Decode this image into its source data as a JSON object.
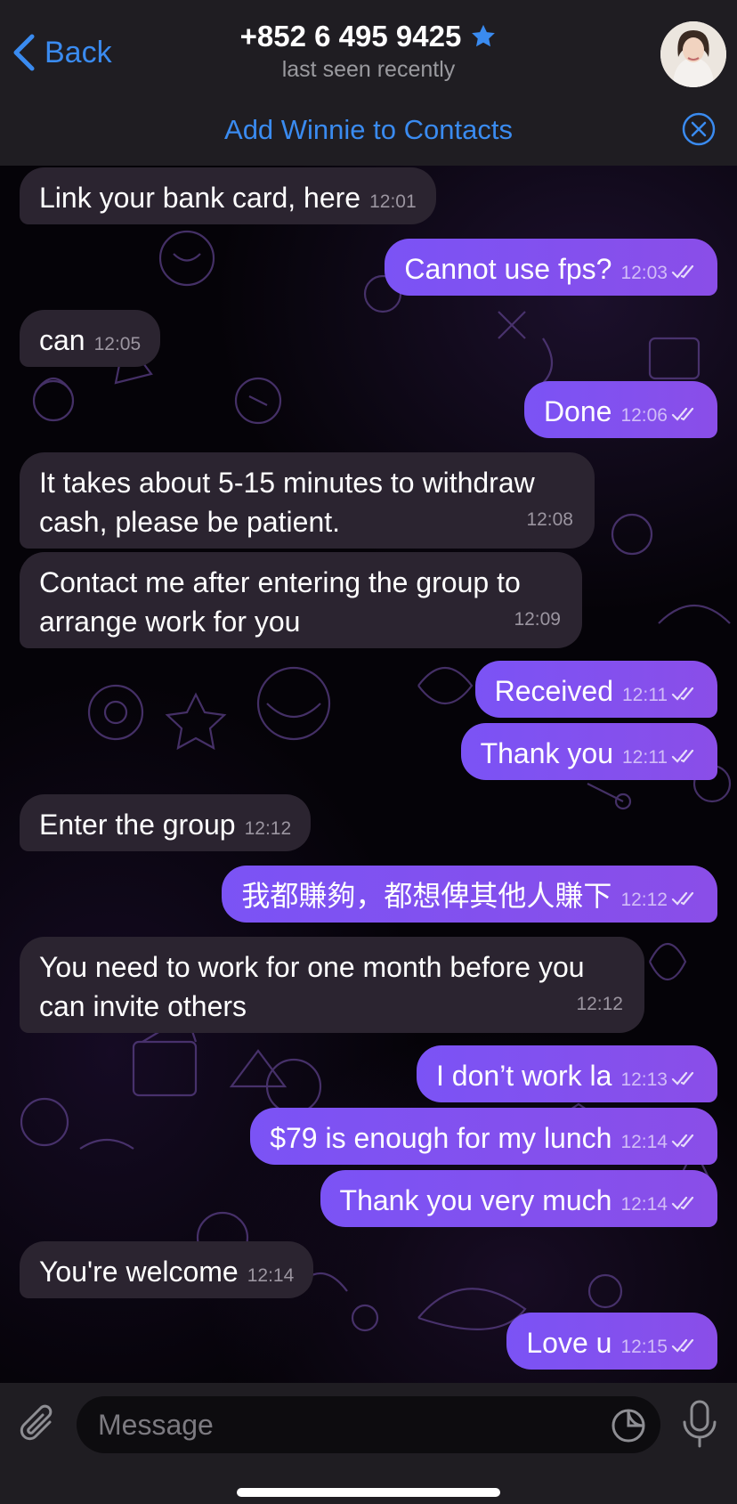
{
  "header": {
    "back_label": "Back",
    "title": "+852 6 495 9425",
    "status": "last seen recently"
  },
  "add_contact": {
    "label": "Add Winnie to Contacts"
  },
  "messages": [
    {
      "dir": "in",
      "text": "Link your bank card, here",
      "time": "12:01"
    },
    {
      "dir": "out",
      "text": "Cannot use fps?",
      "time": "12:03"
    },
    {
      "dir": "in",
      "text": "can",
      "time": "12:05"
    },
    {
      "dir": "out",
      "text": "Done",
      "time": "12:06"
    },
    {
      "dir": "in",
      "text": "It takes about 5-15 minutes to withdraw cash, please be patient.",
      "time": "12:08"
    },
    {
      "dir": "in",
      "text": "Contact me after entering the group to arrange work for you",
      "time": "12:09"
    },
    {
      "dir": "out",
      "text": "Received",
      "time": "12:11"
    },
    {
      "dir": "out",
      "text": "Thank you",
      "time": "12:11"
    },
    {
      "dir": "in",
      "text": "Enter the group",
      "time": "12:12"
    },
    {
      "dir": "out",
      "text": "我都賺夠，都想俾其他人賺下",
      "time": "12:12"
    },
    {
      "dir": "in",
      "text": "You need to work for one month before you can invite others",
      "time": "12:12"
    },
    {
      "dir": "out",
      "text": "I don’t work la",
      "time": "12:13"
    },
    {
      "dir": "out",
      "text": "$79 is enough for my lunch",
      "time": "12:14"
    },
    {
      "dir": "out",
      "text": "Thank you very much",
      "time": "12:14"
    },
    {
      "dir": "in",
      "text": "You're welcome",
      "time": "12:14"
    },
    {
      "dir": "out",
      "text": "Love u",
      "time": "12:15"
    }
  ],
  "composer": {
    "placeholder": "Message"
  },
  "colors": {
    "accent": "#3a8bf0",
    "outgoing": "#7b53f5",
    "incoming": "#2b2430"
  }
}
